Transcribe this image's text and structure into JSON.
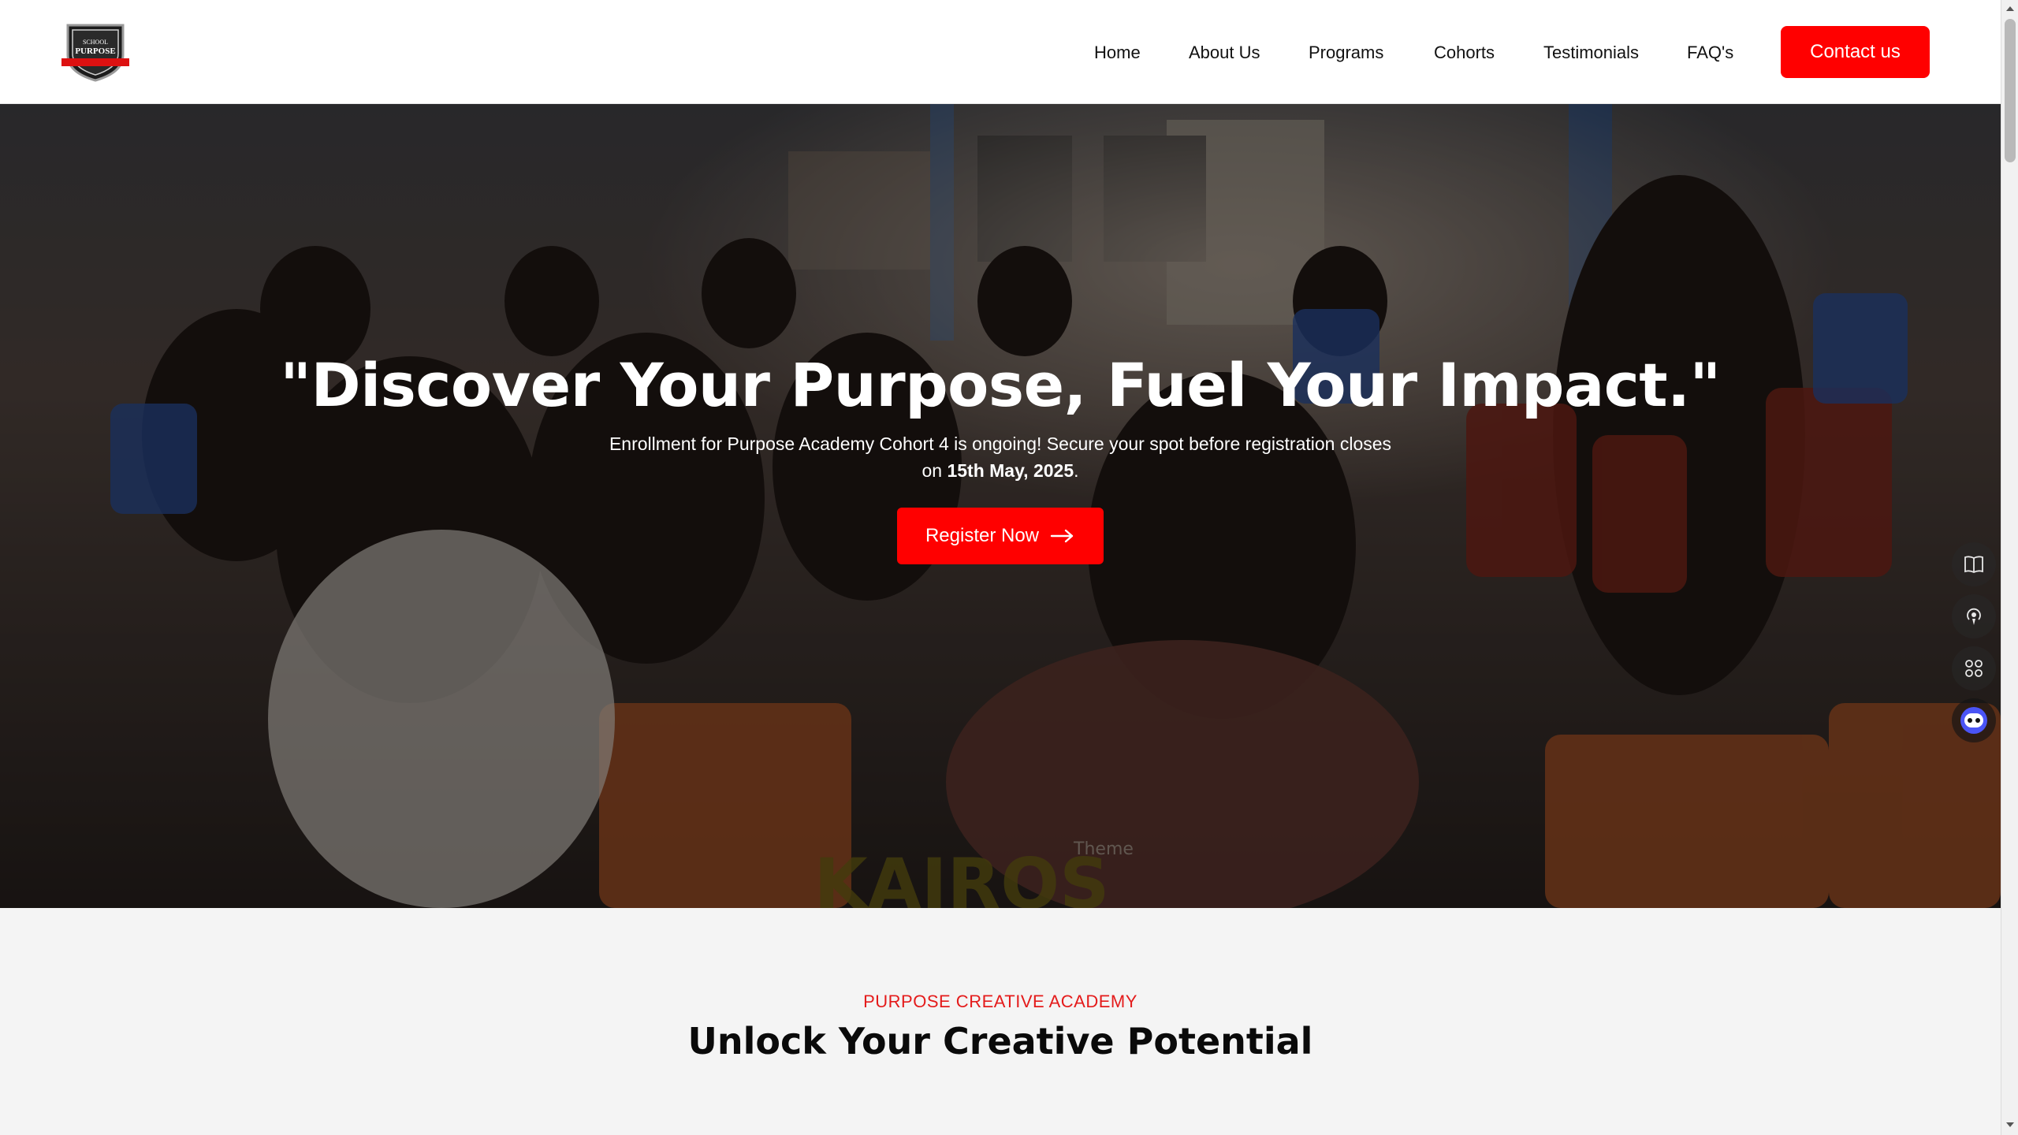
{
  "header": {
    "logo_text_top": "SCHOOL",
    "logo_text_main": "PURPOSE",
    "nav": {
      "home": "Home",
      "about": "About Us",
      "programs": "Programs",
      "cohorts": "Cohorts",
      "testimonials": "Testimonials",
      "faqs": "FAQ's"
    },
    "contact_label": "Contact us"
  },
  "hero": {
    "title": "\"Discover Your Purpose, Fuel Your Impact.\"",
    "subtitle_line1": "Enrollment for Purpose Academy Cohort 4 is ongoing! Secure your spot before registration closes",
    "subtitle_prefix": "on ",
    "subtitle_date": "15th May, 2025",
    "subtitle_suffix": ".",
    "register_label": "Register Now",
    "floor_text": "KAIROS",
    "banner_text": "Theme"
  },
  "section": {
    "eyebrow": "PURPOSE CREATIVE ACADEMY",
    "title": "Unlock Your Creative Potential"
  },
  "side_widgets": [
    "book-icon",
    "podcast-icon",
    "apps-icon",
    "chat-bot-icon"
  ],
  "colors": {
    "accent": "#ff0000",
    "eyebrow": "#e41b1b",
    "section_bg": "#f4f4f4"
  }
}
